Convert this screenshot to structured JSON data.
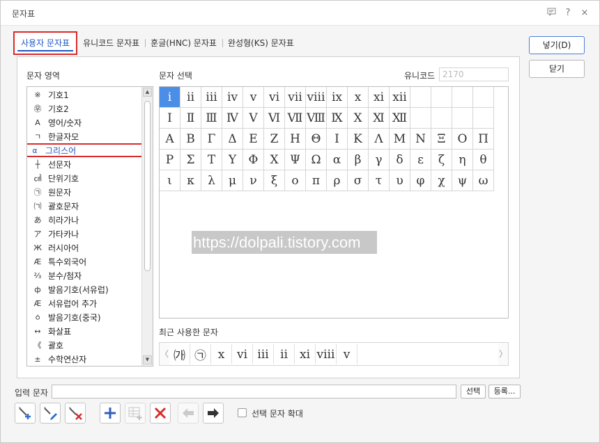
{
  "window": {
    "title": "문자표"
  },
  "tabs": [
    {
      "label": "사용자 문자표"
    },
    {
      "label": "유니코드 문자표"
    },
    {
      "label": "훈글(HNC) 문자표"
    },
    {
      "label": "완성형(KS) 문자표"
    }
  ],
  "labels": {
    "category_area": "문자 영역",
    "char_select": "문자 선택",
    "unicode": "유니코드",
    "recent": "최근 사용한 문자",
    "input_chars": "입력 문자",
    "enlarge": "선택 문자 확대"
  },
  "unicode_value": "2170",
  "buttons": {
    "insert": "넣기(D)",
    "close": "닫기",
    "select": "선택",
    "register": "등록..."
  },
  "categories": [
    {
      "icon": "※",
      "label": "기호1"
    },
    {
      "icon": "㉾",
      "label": "기호2"
    },
    {
      "icon": "A",
      "label": "영어/숫자"
    },
    {
      "icon": "ㄱ",
      "label": "한글자모"
    },
    {
      "icon": "α",
      "label": "그리스어"
    },
    {
      "icon": "┼",
      "label": "선문자"
    },
    {
      "icon": "㎠",
      "label": "단위기호"
    },
    {
      "icon": "㉠",
      "label": "원문자"
    },
    {
      "icon": "㈀",
      "label": "괄호문자"
    },
    {
      "icon": "あ",
      "label": "히라가나"
    },
    {
      "icon": "ア",
      "label": "가타카나"
    },
    {
      "icon": "Ж",
      "label": "러시아어"
    },
    {
      "icon": "Æ",
      "label": "특수외국어"
    },
    {
      "icon": "⅔",
      "label": "분수/첨자"
    },
    {
      "icon": "ф",
      "label": "발음기호(서유럽)"
    },
    {
      "icon": "Æ",
      "label": "서유럽어 추가"
    },
    {
      "icon": "ㆁ",
      "label": "발음기호(중국)"
    },
    {
      "icon": "↔",
      "label": "화살표"
    },
    {
      "icon": "《",
      "label": "괄호"
    },
    {
      "icon": "±",
      "label": "수학연산자"
    }
  ],
  "characters": [
    [
      "ⅰ",
      "ⅱ",
      "ⅲ",
      "ⅳ",
      "ⅴ",
      "ⅵ",
      "ⅶ",
      "ⅷ",
      "ⅸ",
      "ⅹ",
      "ⅺ",
      "ⅻ",
      "",
      "",
      "",
      ""
    ],
    [
      "Ⅰ",
      "Ⅱ",
      "Ⅲ",
      "Ⅳ",
      "Ⅴ",
      "Ⅵ",
      "Ⅶ",
      "Ⅷ",
      "Ⅸ",
      "Ⅹ",
      "Ⅺ",
      "Ⅻ",
      "",
      "",
      "",
      ""
    ],
    [
      "Α",
      "Β",
      "Γ",
      "Δ",
      "Ε",
      "Ζ",
      "Η",
      "Θ",
      "Ι",
      "Κ",
      "Λ",
      "Μ",
      "Ν",
      "Ξ",
      "Ο",
      "Π"
    ],
    [
      "Ρ",
      "Σ",
      "Τ",
      "Υ",
      "Φ",
      "Χ",
      "Ψ",
      "Ω",
      "α",
      "β",
      "γ",
      "δ",
      "ε",
      "ζ",
      "η",
      "θ"
    ],
    [
      "ι",
      "κ",
      "λ",
      "μ",
      "ν",
      "ξ",
      "ο",
      "π",
      "ρ",
      "σ",
      "τ",
      "υ",
      "φ",
      "χ",
      "ψ",
      "ω"
    ]
  ],
  "recent_chars": [
    "㈎",
    "㉠",
    "x",
    "ⅵ",
    "ⅲ",
    "ⅱ",
    "ⅺ",
    "ⅷ",
    "ⅴ"
  ],
  "watermark": "https://dolpali.tistory.com",
  "icons": {
    "help": "?",
    "close": "×",
    "comment": "speech-bubble-icon"
  },
  "colors": {
    "accent": "#1f57c3",
    "highlight": "#d92a2a",
    "selected_cell": "#4a8ee8"
  }
}
